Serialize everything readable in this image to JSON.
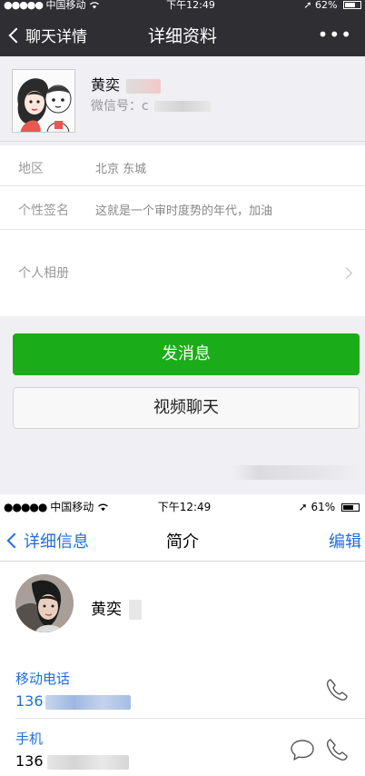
{
  "wechat": {
    "status": {
      "carrier": "中国移动",
      "time": "下午12:49",
      "battery": "62%"
    },
    "nav": {
      "back_label": "聊天详情",
      "title": "详细资料",
      "more_label": "•••"
    },
    "profile": {
      "name": "黄奕",
      "wxid_label": "微信号：",
      "wxid_visible": "c"
    },
    "info_rows": [
      {
        "key": "地区",
        "value": "北京 东城"
      },
      {
        "key": "个性签名",
        "value": "这就是一个审时度势的年代，加油"
      },
      {
        "key": "个人相册",
        "value": ""
      }
    ],
    "buttons": {
      "send_message": "发消息",
      "video_chat": "视频聊天"
    },
    "colors": {
      "navbar": "#2f2f33",
      "primary_button": "#1aad19",
      "background": "#efeff4"
    }
  },
  "contact": {
    "status": {
      "carrier": "中国移动",
      "time": "下午12:49",
      "battery": "61%"
    },
    "nav": {
      "back_label": "详细信息",
      "title": "简介",
      "edit_label": "编辑"
    },
    "name": "黄奕",
    "fields": [
      {
        "label": "移动电话",
        "number": "136",
        "icons": [
          "phone-icon"
        ]
      },
      {
        "label": "手机",
        "number": "136",
        "icons": [
          "message-icon",
          "phone-icon"
        ]
      }
    ],
    "colors": {
      "accent": "#1e6fd9"
    }
  }
}
